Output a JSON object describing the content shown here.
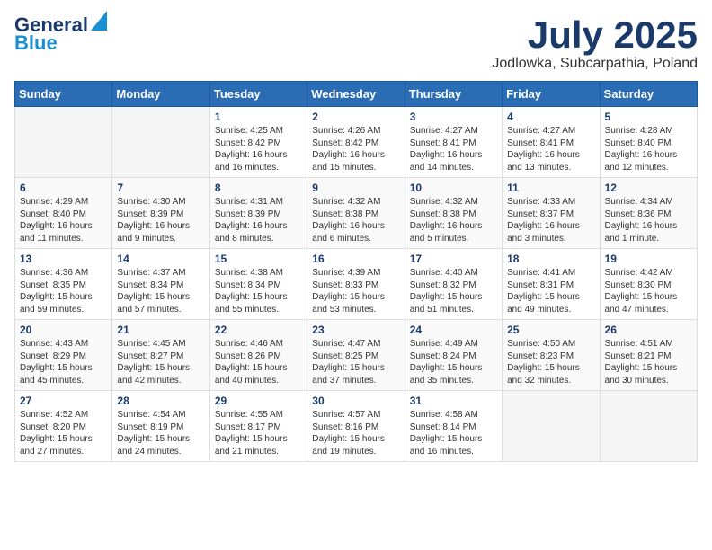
{
  "header": {
    "logo_line1": "General",
    "logo_line2": "Blue",
    "main_title": "July 2025",
    "sub_title": "Jodlowka, Subcarpathia, Poland"
  },
  "calendar": {
    "days_of_week": [
      "Sunday",
      "Monday",
      "Tuesday",
      "Wednesday",
      "Thursday",
      "Friday",
      "Saturday"
    ],
    "weeks": [
      [
        {
          "day": "",
          "info": ""
        },
        {
          "day": "",
          "info": ""
        },
        {
          "day": "1",
          "info": "Sunrise: 4:25 AM\nSunset: 8:42 PM\nDaylight: 16 hours\nand 16 minutes."
        },
        {
          "day": "2",
          "info": "Sunrise: 4:26 AM\nSunset: 8:42 PM\nDaylight: 16 hours\nand 15 minutes."
        },
        {
          "day": "3",
          "info": "Sunrise: 4:27 AM\nSunset: 8:41 PM\nDaylight: 16 hours\nand 14 minutes."
        },
        {
          "day": "4",
          "info": "Sunrise: 4:27 AM\nSunset: 8:41 PM\nDaylight: 16 hours\nand 13 minutes."
        },
        {
          "day": "5",
          "info": "Sunrise: 4:28 AM\nSunset: 8:40 PM\nDaylight: 16 hours\nand 12 minutes."
        }
      ],
      [
        {
          "day": "6",
          "info": "Sunrise: 4:29 AM\nSunset: 8:40 PM\nDaylight: 16 hours\nand 11 minutes."
        },
        {
          "day": "7",
          "info": "Sunrise: 4:30 AM\nSunset: 8:39 PM\nDaylight: 16 hours\nand 9 minutes."
        },
        {
          "day": "8",
          "info": "Sunrise: 4:31 AM\nSunset: 8:39 PM\nDaylight: 16 hours\nand 8 minutes."
        },
        {
          "day": "9",
          "info": "Sunrise: 4:32 AM\nSunset: 8:38 PM\nDaylight: 16 hours\nand 6 minutes."
        },
        {
          "day": "10",
          "info": "Sunrise: 4:32 AM\nSunset: 8:38 PM\nDaylight: 16 hours\nand 5 minutes."
        },
        {
          "day": "11",
          "info": "Sunrise: 4:33 AM\nSunset: 8:37 PM\nDaylight: 16 hours\nand 3 minutes."
        },
        {
          "day": "12",
          "info": "Sunrise: 4:34 AM\nSunset: 8:36 PM\nDaylight: 16 hours\nand 1 minute."
        }
      ],
      [
        {
          "day": "13",
          "info": "Sunrise: 4:36 AM\nSunset: 8:35 PM\nDaylight: 15 hours\nand 59 minutes."
        },
        {
          "day": "14",
          "info": "Sunrise: 4:37 AM\nSunset: 8:34 PM\nDaylight: 15 hours\nand 57 minutes."
        },
        {
          "day": "15",
          "info": "Sunrise: 4:38 AM\nSunset: 8:34 PM\nDaylight: 15 hours\nand 55 minutes."
        },
        {
          "day": "16",
          "info": "Sunrise: 4:39 AM\nSunset: 8:33 PM\nDaylight: 15 hours\nand 53 minutes."
        },
        {
          "day": "17",
          "info": "Sunrise: 4:40 AM\nSunset: 8:32 PM\nDaylight: 15 hours\nand 51 minutes."
        },
        {
          "day": "18",
          "info": "Sunrise: 4:41 AM\nSunset: 8:31 PM\nDaylight: 15 hours\nand 49 minutes."
        },
        {
          "day": "19",
          "info": "Sunrise: 4:42 AM\nSunset: 8:30 PM\nDaylight: 15 hours\nand 47 minutes."
        }
      ],
      [
        {
          "day": "20",
          "info": "Sunrise: 4:43 AM\nSunset: 8:29 PM\nDaylight: 15 hours\nand 45 minutes."
        },
        {
          "day": "21",
          "info": "Sunrise: 4:45 AM\nSunset: 8:27 PM\nDaylight: 15 hours\nand 42 minutes."
        },
        {
          "day": "22",
          "info": "Sunrise: 4:46 AM\nSunset: 8:26 PM\nDaylight: 15 hours\nand 40 minutes."
        },
        {
          "day": "23",
          "info": "Sunrise: 4:47 AM\nSunset: 8:25 PM\nDaylight: 15 hours\nand 37 minutes."
        },
        {
          "day": "24",
          "info": "Sunrise: 4:49 AM\nSunset: 8:24 PM\nDaylight: 15 hours\nand 35 minutes."
        },
        {
          "day": "25",
          "info": "Sunrise: 4:50 AM\nSunset: 8:23 PM\nDaylight: 15 hours\nand 32 minutes."
        },
        {
          "day": "26",
          "info": "Sunrise: 4:51 AM\nSunset: 8:21 PM\nDaylight: 15 hours\nand 30 minutes."
        }
      ],
      [
        {
          "day": "27",
          "info": "Sunrise: 4:52 AM\nSunset: 8:20 PM\nDaylight: 15 hours\nand 27 minutes."
        },
        {
          "day": "28",
          "info": "Sunrise: 4:54 AM\nSunset: 8:19 PM\nDaylight: 15 hours\nand 24 minutes."
        },
        {
          "day": "29",
          "info": "Sunrise: 4:55 AM\nSunset: 8:17 PM\nDaylight: 15 hours\nand 21 minutes."
        },
        {
          "day": "30",
          "info": "Sunrise: 4:57 AM\nSunset: 8:16 PM\nDaylight: 15 hours\nand 19 minutes."
        },
        {
          "day": "31",
          "info": "Sunrise: 4:58 AM\nSunset: 8:14 PM\nDaylight: 15 hours\nand 16 minutes."
        },
        {
          "day": "",
          "info": ""
        },
        {
          "day": "",
          "info": ""
        }
      ]
    ]
  }
}
